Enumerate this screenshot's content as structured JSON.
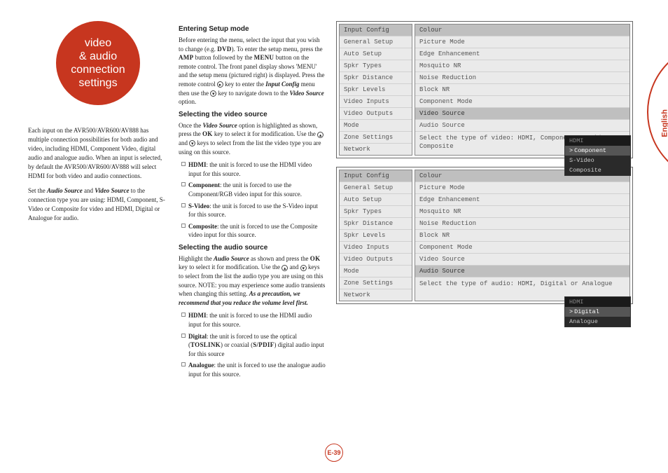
{
  "side_tab": "English",
  "page_number": "E-39",
  "circle_title": [
    "video",
    "& audio",
    "connection",
    "settings"
  ],
  "intro": {
    "p1": "Each input on the AVR500/AVR600/AV888 has multiple connection possibilities for both audio and video, including HDMI, Component Video, digital audio and analogue audio. When an input is selected, by default the AVR500/AVR600/AV888 will select HDMI for both video and audio connections.",
    "p2_pre": "Set the ",
    "p2_b1": "Audio Source",
    "p2_mid": " and ",
    "p2_b2": "Video Source",
    "p2_post": " to the connection type you are using: HDMI, Component, S-Video or Composite for video and HDMI, Digital or Analogue for audio."
  },
  "sections": {
    "entering": {
      "title": "Entering Setup mode",
      "body_pre": "Before entering the menu, select the input that you wish to change (e.g. ",
      "body_dvd": "DVD",
      "body_mid1": "). To enter the setup menu, press the ",
      "body_amp": "AMP",
      "body_mid2": " button followed by the ",
      "body_menu": "MENU",
      "body_mid3": " button on the remote control. The front panel display shows '",
      "body_menutext": "MENU",
      "body_mid4": "' and the setup menu (pictured right) is displayed. Press the remote control ",
      "body_mid5": " key to enter the ",
      "body_inputconfig": "Input Config",
      "body_mid6": " menu then use the ",
      "body_mid7": " key to navigate down to the ",
      "body_vidsrc": "Video Source",
      "body_end": " option."
    },
    "video": {
      "title": "Selecting the video source",
      "body_pre": "Once the ",
      "body_b1": "Video Source",
      "body_mid1": " option is highlighted as shown, press the ",
      "body_ok": "OK",
      "body_mid2": " key to select it for modification. Use the ",
      "body_mid3": " and ",
      "body_end": " keys to select from the list the video type you are using on this source.",
      "bullets": [
        {
          "b": "HDMI",
          "t": ": the unit is forced to use the HDMI video input for this source."
        },
        {
          "b": "Component",
          "t": ": the unit is forced to use the Component/RGB video input for this source."
        },
        {
          "b": "S-Video",
          "t": ": the unit is forced to use the S-Video input for this source."
        },
        {
          "b": "Composite",
          "t": ": the unit is forced to use the Composite video input for this source."
        }
      ]
    },
    "audio": {
      "title": "Selecting the audio source",
      "body_pre": "Highlight the ",
      "body_b1": "Audio Source",
      "body_mid1": " as shown and press the ",
      "body_ok": "OK",
      "body_mid2": " key to select it for modification. Use the ",
      "body_mid3": " and ",
      "body_mid4": " keys to select from the list the audio type you are using on this source. NOTE: you may experience some audio transients when changing this setting. ",
      "body_bold": "As a precaution, we recommend that you reduce the volume level first.",
      "bullets": [
        {
          "b": "HDMI",
          "t": ": the unit is forced to use the HDMI audio input for this source."
        },
        {
          "b": "Digital",
          "t_pre": ": the unit is forced to use the optical (",
          "t_tos": "TOSLINK",
          "t_mid": ") or coaxial (",
          "t_sp": "S/PDIF",
          "t_post": ") digital audio input for this source"
        },
        {
          "b": "Analogue",
          "t": ": the unit is forced to use the analogue audio input for this source."
        }
      ]
    }
  },
  "menu": {
    "left_items": [
      "Input Config",
      "General Setup",
      "Auto Setup",
      "Spkr Types",
      "Spkr Distance",
      "Spkr Levels",
      "Video Inputs",
      "Video Outputs",
      "Mode",
      "Zone Settings",
      "Network"
    ],
    "right_items": [
      "Colour",
      "Picture Mode",
      "Edge Enhancement",
      "Mosquito NR",
      "Noise Reduction",
      "Block NR",
      "Component Mode",
      "Video Source",
      "Audio Source"
    ],
    "panel1": {
      "selected_right": "Video Source",
      "help": "Select the type of video: HDMI, Component, S-Video or Composite",
      "popup_header": "HDMI",
      "popup_sel": "Component",
      "popup_rest": [
        "S-Video",
        "Composite"
      ]
    },
    "panel2": {
      "selected_right": "Audio Source",
      "help": "Select the type of audio: HDMI, Digital or Analogue",
      "popup_header": "HDMI",
      "popup_sel": "Digital",
      "popup_rest": [
        "Analogue"
      ]
    }
  }
}
